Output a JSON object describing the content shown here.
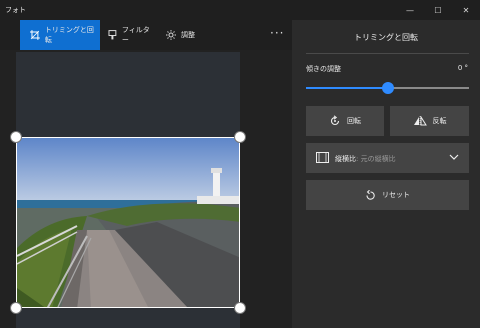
{
  "app": {
    "title": "フォト",
    "minimize": "—",
    "maximize": "☐",
    "close": "✕"
  },
  "toolbar": {
    "tabs": [
      {
        "label": "トリミングと回転",
        "icon": "crop-rotate-icon",
        "active": true
      },
      {
        "label": "フィルター",
        "icon": "filter-icon",
        "active": false
      },
      {
        "label": "調整",
        "icon": "adjust-sun-icon",
        "active": false
      }
    ],
    "more": "···"
  },
  "panel": {
    "title": "トリミングと回転",
    "straighten_label": "傾きの調整",
    "straighten_value": "0 °",
    "straighten_level": 0.5,
    "rotate_label": "回転",
    "flip_label": "反転",
    "aspect_label": "縦横比",
    "aspect_value": ": 元の縦横比",
    "reset_label": "リセット"
  },
  "colors": {
    "accent": "#0f6fd1",
    "slider": "#2f8bff",
    "panel_bg": "#2b2b2b",
    "button_bg": "#444444"
  }
}
